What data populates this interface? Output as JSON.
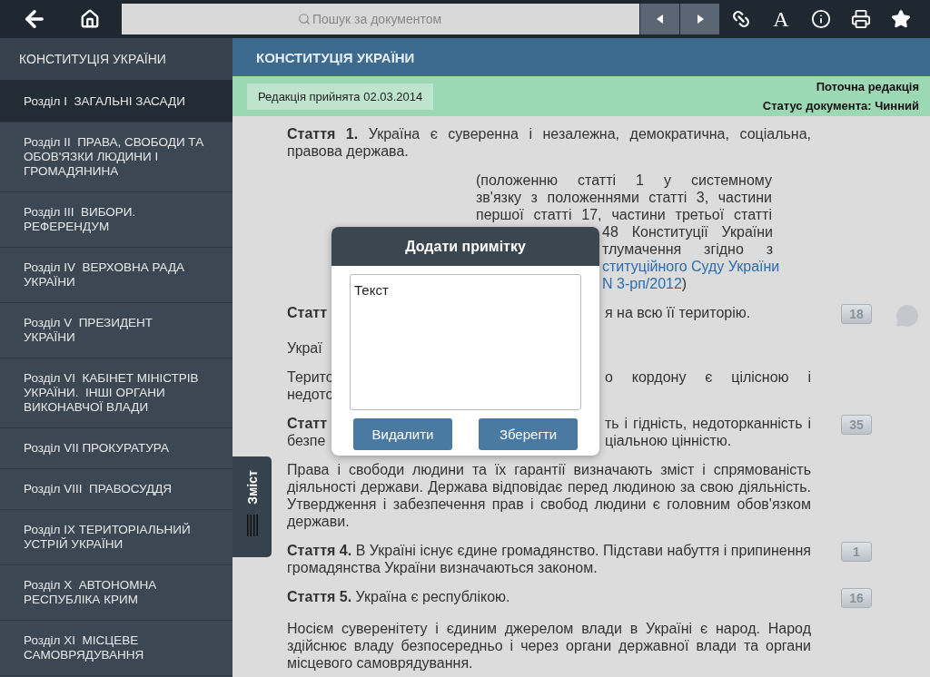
{
  "toolbar": {
    "search_placeholder": "Пошук за документом",
    "font_button": "A"
  },
  "sidebar": {
    "title": "КОНСТИТУЦІЯ УКРАЇНИ",
    "items": [
      {
        "label": "Розділ I  ЗАГАЛЬНІ ЗАСАДИ",
        "selected": true
      },
      {
        "label": "Розділ II  ПРАВА, СВОБОДИ ТА ОБОВ'ЯЗКИ ЛЮДИНИ І ГРОМАДЯНИНА",
        "selected": false
      },
      {
        "label": "Розділ III  ВИБОРИ. РЕФЕРЕНДУМ",
        "selected": false
      },
      {
        "label": "Розділ IV  ВЕРХОВНА РАДА УКРАЇНИ",
        "selected": false
      },
      {
        "label": "Розділ V  ПРЕЗИДЕНТ УКРАЇНИ",
        "selected": false
      },
      {
        "label": "Розділ VI  КАБІНЕТ МІНІСТРІВ УКРАЇНИ.  ІНШІ ОРГАНИ ВИКОНАВЧОЇ ВЛАДИ",
        "selected": false
      },
      {
        "label": "Розділ VII ПРОКУРАТУРА",
        "selected": false
      },
      {
        "label": "Розділ VIII  ПРАВОСУДДЯ",
        "selected": false
      },
      {
        "label": "Розділ IX ТЕРИТОРІАЛЬНИЙ УСТРІЙ УКРАЇНИ",
        "selected": false
      },
      {
        "label": "Розділ X  АВТОНОМНА РЕСПУБЛІКА КРИМ",
        "selected": false
      },
      {
        "label": "Розділ XI  МІСЦЕВЕ САМОВРЯДУВАННЯ",
        "selected": false
      }
    ]
  },
  "toc_tab": {
    "label": "Зміст"
  },
  "document": {
    "title": "КОНСТИТУЦІЯ УКРАЇНИ",
    "edition": "Редакція прийнята 02.03.2014",
    "status_lines": [
      "Поточна редакція",
      "Статус документа: Чинний"
    ],
    "blocks": [
      {
        "kind": "para",
        "text": "**Стаття 1.** Україна є суверенна і незалежна, демократична, соціальна, правова держава."
      },
      {
        "kind": "note",
        "lines": [
          "(положенню статті 1 у системному",
          "зв'язку з положеннями статті 3, частини",
          "першої статті 17, частини третьої статті"
        ],
        "fragments": [
          {
            "text": "48 Конституції України",
            "link": false
          },
          {
            "text": "тлумачення згідно з",
            "link": false
          },
          {
            "text": "ституційного Суду України",
            "link": true
          },
          {
            "text": "N 3-рп/2012",
            "tail": ")",
            "link": true
          }
        ]
      },
      {
        "kind": "split",
        "lines": [
          {
            "left": "Статт",
            "bold": true,
            "right": "я на всю її територію."
          }
        ],
        "badge": "18",
        "comment": true
      },
      {
        "kind": "split",
        "lines": [
          {
            "left": "Украї",
            "bold": false
          }
        ]
      },
      {
        "kind": "split",
        "lines": [
          {
            "left": "Терито",
            "bold": false,
            "right": "о кордону є цілісною і"
          },
          {
            "left": "недото",
            "bold": false
          }
        ]
      },
      {
        "kind": "split",
        "lines": [
          {
            "left": "Статт",
            "bold": true,
            "right": "ть і гідність, недоторканність і"
          },
          {
            "left": "безпе",
            "bold": false,
            "right": "ціальною цінністю."
          }
        ],
        "badge": "35"
      },
      {
        "kind": "para",
        "text": "Права і свободи людини та їх гарантії визначають зміст і спрямованість діяльності держави. Держава відповідає перед людиною за свою діяльність. Утвердження і забезпечення прав і свобод людини є головним обов'язком держави."
      },
      {
        "kind": "para",
        "text": "**Стаття 4.** В Україні існує єдине громадянство. Підстави набуття і припинення громадянства України визначаються законом.",
        "badge": "1"
      },
      {
        "kind": "para",
        "text": "**Стаття 5.** Україна є республікою.",
        "badge": "16"
      },
      {
        "kind": "para",
        "text": "Носієм суверенітету і єдиним джерелом влади в Україні є народ. Народ здійснює владу безпосередньо і через органи державної влади та органи місцевого самоврядування."
      }
    ]
  },
  "dialog": {
    "title": "Додати примітку",
    "value": "Текст",
    "buttons": [
      "Видалити",
      "Зберегти"
    ]
  }
}
